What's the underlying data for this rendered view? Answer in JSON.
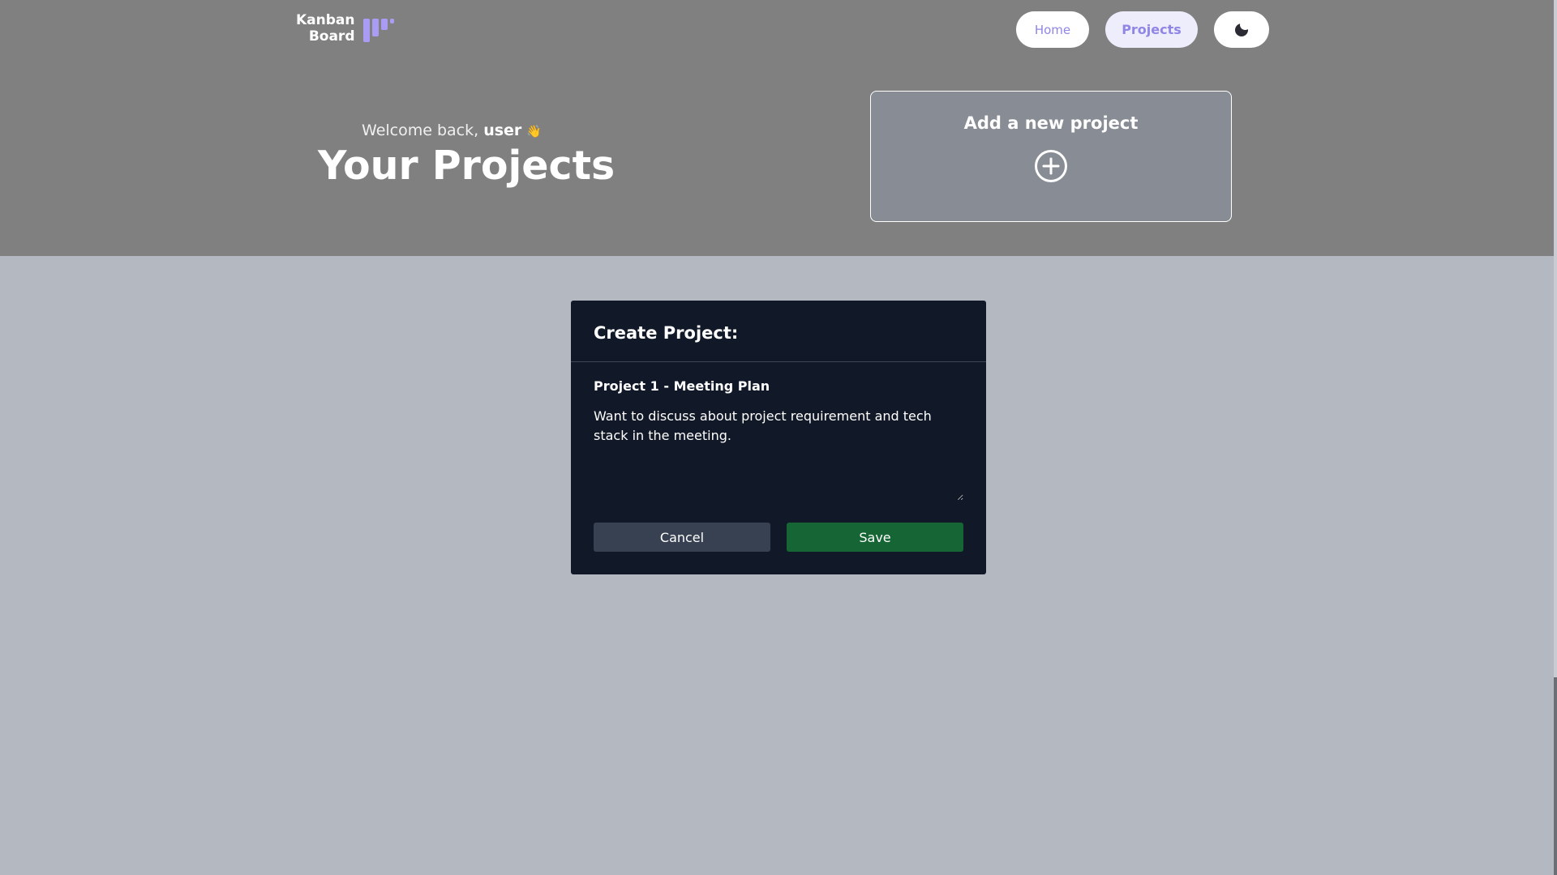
{
  "logo": {
    "line1": "Kanban",
    "line2": "Board",
    "accent": "#a89cf5"
  },
  "nav": {
    "home_label": "Home",
    "projects_label": "Projects",
    "theme_icon": "moon-icon"
  },
  "welcome": {
    "prefix": "Welcome back, ",
    "username": "user",
    "emoji": "👋"
  },
  "page_title": "Your Projects",
  "add_card": {
    "title": "Add a new project",
    "icon": "plus-circle-icon"
  },
  "modal": {
    "title": "Create Project:",
    "project_name": "Project 1 - Meeting Plan",
    "description": "Want to discuss about project requirement and tech stack in the meeting.",
    "cancel_label": "Cancel",
    "save_label": "Save"
  },
  "colors": {
    "header_bg": "#808080",
    "page_bg": "#b4b8c0",
    "modal_bg": "#111827",
    "cancel_bg": "#374151",
    "save_bg": "#166534"
  }
}
